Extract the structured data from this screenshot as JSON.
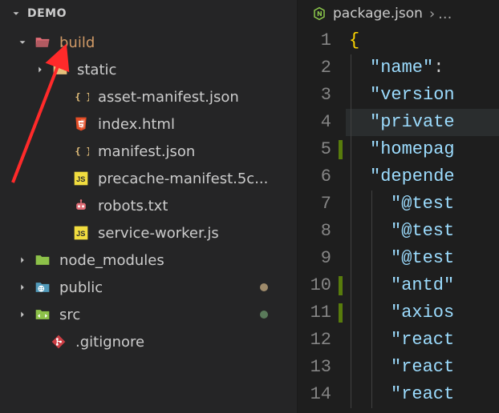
{
  "sidebar": {
    "title": "DEMO",
    "items": [
      {
        "label": "build",
        "kind": "folder-open",
        "color": "#e06c75",
        "indent": 1,
        "expanded": true,
        "arrow": true
      },
      {
        "label": "static",
        "kind": "folder",
        "color": "#e5c07b",
        "indent": 2,
        "expanded": false,
        "arrow": true
      },
      {
        "label": "asset-manifest.json",
        "kind": "braces",
        "color": "#e5c07b",
        "indent": 3
      },
      {
        "label": "index.html",
        "kind": "html5",
        "color": "#e44d26",
        "indent": 3
      },
      {
        "label": "manifest.json",
        "kind": "braces",
        "color": "#e5c07b",
        "indent": 3
      },
      {
        "label": "precache-manifest.5c...",
        "kind": "js",
        "color": "#f1dd3f",
        "indent": 3
      },
      {
        "label": "robots.txt",
        "kind": "robot",
        "color": "#e06c75",
        "indent": 3
      },
      {
        "label": "service-worker.js",
        "kind": "js",
        "color": "#f1dd3f",
        "indent": 3
      },
      {
        "label": "node_modules",
        "kind": "folder",
        "color": "#8dc149",
        "indent": 1,
        "expanded": false,
        "arrow": true
      },
      {
        "label": "public",
        "kind": "folder-web",
        "color": "#519aba",
        "indent": 1,
        "expanded": false,
        "arrow": true,
        "dot": "tan"
      },
      {
        "label": "src",
        "kind": "folder-src",
        "color": "#8dc149",
        "indent": 1,
        "expanded": false,
        "arrow": true,
        "dot": "green"
      },
      {
        "label": ".gitignore",
        "kind": "git",
        "color": "#cc3e44",
        "indent": 2
      }
    ]
  },
  "editor": {
    "tab": {
      "filename": "package.json"
    },
    "lines": [
      {
        "n": 1,
        "type": "brace",
        "text": "{"
      },
      {
        "n": 2,
        "type": "key",
        "indent": 1,
        "key": "\"name\"",
        "tail": ":"
      },
      {
        "n": 3,
        "type": "key",
        "indent": 1,
        "key": "\"version"
      },
      {
        "n": 4,
        "type": "key",
        "indent": 1,
        "key": "\"private",
        "hl": true
      },
      {
        "n": 5,
        "type": "key",
        "indent": 1,
        "key": "\"homepag",
        "mark": true
      },
      {
        "n": 6,
        "type": "key",
        "indent": 1,
        "key": "\"depende"
      },
      {
        "n": 7,
        "type": "key",
        "indent": 2,
        "key": "\"@test"
      },
      {
        "n": 8,
        "type": "key",
        "indent": 2,
        "key": "\"@test"
      },
      {
        "n": 9,
        "type": "key",
        "indent": 2,
        "key": "\"@test"
      },
      {
        "n": 10,
        "type": "key",
        "indent": 2,
        "key": "\"antd\"",
        "mark": true
      },
      {
        "n": 11,
        "type": "key",
        "indent": 2,
        "key": "\"axios",
        "mark": true
      },
      {
        "n": 12,
        "type": "key",
        "indent": 2,
        "key": "\"react"
      },
      {
        "n": 13,
        "type": "key",
        "indent": 2,
        "key": "\"react"
      },
      {
        "n": 14,
        "type": "key",
        "indent": 2,
        "key": "\"react"
      }
    ]
  }
}
